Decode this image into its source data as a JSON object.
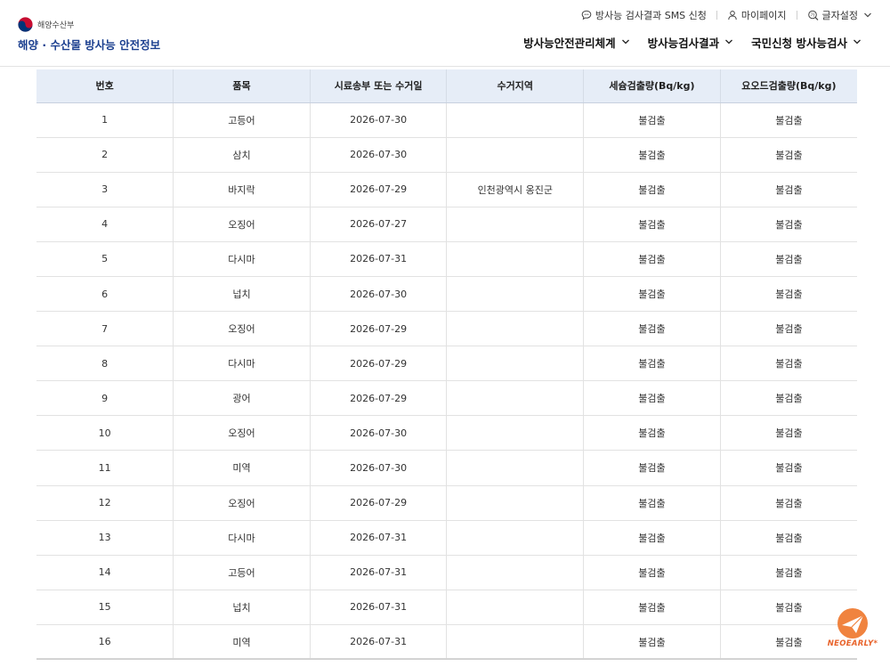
{
  "header": {
    "ministry": "해양수산부",
    "site_title": "해양 · 수산물 방사능 안전정보",
    "util": {
      "sms": "방사능 검사결과 SMS 신청",
      "mypage": "마이페이지",
      "font_setting": "글자설정"
    },
    "nav": [
      {
        "label": "방사능안전관리체계"
      },
      {
        "label": "방사능검사결과"
      },
      {
        "label": "국민신청 방사능검사"
      }
    ]
  },
  "table": {
    "headers": [
      "번호",
      "품목",
      "시료송부 또는 수거일",
      "수거지역",
      "세슘검출량(Bq/kg)",
      "요오드검출량(Bq/kg)"
    ],
    "rows": [
      [
        "1",
        "고등어",
        "2026-07-30",
        "",
        "불검출",
        "불검출"
      ],
      [
        "2",
        "삼치",
        "2026-07-30",
        "",
        "불검출",
        "불검출"
      ],
      [
        "3",
        "바지락",
        "2026-07-29",
        "인천광역시 옹진군",
        "불검출",
        "불검출"
      ],
      [
        "4",
        "오징어",
        "2026-07-27",
        "",
        "불검출",
        "불검출"
      ],
      [
        "5",
        "다시마",
        "2026-07-31",
        "",
        "불검출",
        "불검출"
      ],
      [
        "6",
        "넙치",
        "2026-07-30",
        "",
        "불검출",
        "불검출"
      ],
      [
        "7",
        "오징어",
        "2026-07-29",
        "",
        "불검출",
        "불검출"
      ],
      [
        "8",
        "다시마",
        "2026-07-29",
        "",
        "불검출",
        "불검출"
      ],
      [
        "9",
        "광어",
        "2026-07-29",
        "",
        "불검출",
        "불검출"
      ],
      [
        "10",
        "오징어",
        "2026-07-30",
        "",
        "불검출",
        "불검출"
      ],
      [
        "11",
        "미역",
        "2026-07-30",
        "",
        "불검출",
        "불검출"
      ],
      [
        "12",
        "오징어",
        "2026-07-29",
        "",
        "불검출",
        "불검출"
      ],
      [
        "13",
        "다시마",
        "2026-07-31",
        "",
        "불검출",
        "불검출"
      ],
      [
        "14",
        "고등어",
        "2026-07-31",
        "",
        "불검출",
        "불검출"
      ],
      [
        "15",
        "넙치",
        "2026-07-31",
        "",
        "불검출",
        "불검출"
      ],
      [
        "16",
        "미역",
        "2026-07-31",
        "",
        "불검출",
        "불검출"
      ]
    ]
  },
  "badge": {
    "text": "NEOEARLY*",
    "icon": "paper-plane-icon",
    "color": "#e8632b"
  },
  "colors": {
    "brand": "#1b3f8f",
    "table_header_bg": "#e6edf7"
  }
}
